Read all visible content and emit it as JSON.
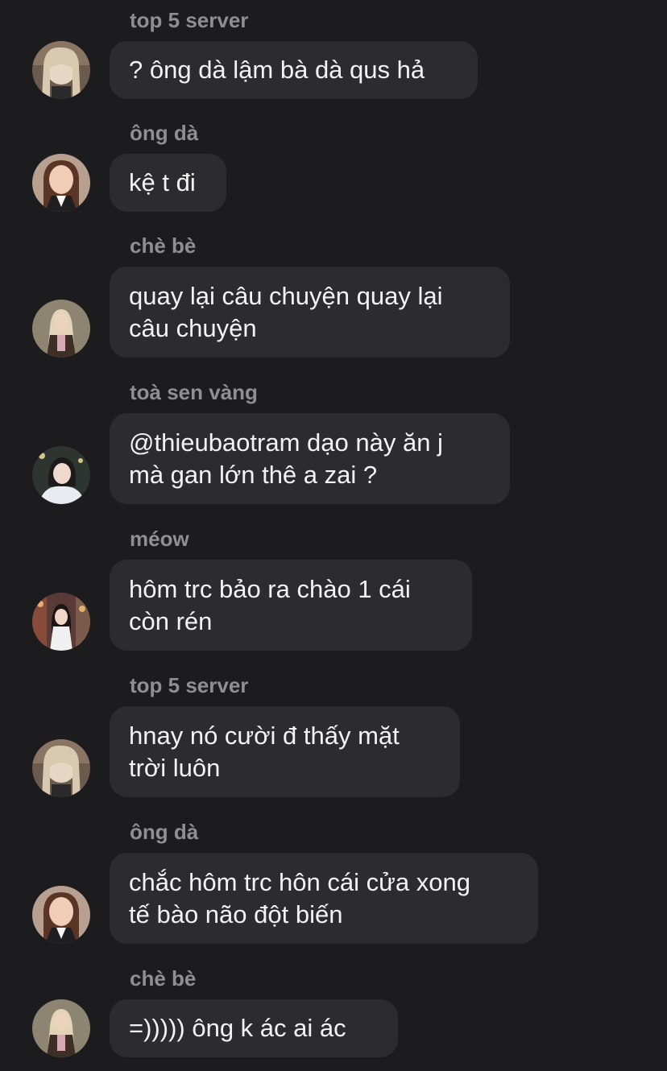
{
  "messages": [
    {
      "sender": "top 5 server",
      "text": "? ông dà lậm bà dà qus hả",
      "avatar": "avatar-blonde-girl"
    },
    {
      "sender": "ông dà",
      "text": "kệ t đi",
      "avatar": "avatar-brunette-suit"
    },
    {
      "sender": "chè bè",
      "text": "quay lại câu chuyện quay lại\ncâu chuyện",
      "avatar": "avatar-blonde-jacket"
    },
    {
      "sender": "toà sen vàng",
      "text": "@thieubaotram dạo này ăn j\nmà gan lớn thê a zai ?",
      "avatar": "avatar-white-fur"
    },
    {
      "sender": "méow",
      "text": "hôm trc bảo ra chào 1 cái\ncòn rén",
      "avatar": "avatar-street-girl"
    },
    {
      "sender": "top 5 server",
      "text": "hnay nó cười đ thấy mặt\ntrời luôn",
      "avatar": "avatar-blonde-girl"
    },
    {
      "sender": "ông dà",
      "text": "chắc hôm trc hôn cái cửa xong\ntế bào não đột biến",
      "avatar": "avatar-brunette-suit"
    },
    {
      "sender": "chè bè",
      "text": "=))))) ông k ác ai ác",
      "avatar": "avatar-blonde-jacket"
    }
  ],
  "colors": {
    "background": "#1c1c1e",
    "bubble": "#2c2c2e",
    "sender": "#8e8e93",
    "text": "#f2f2f7"
  }
}
